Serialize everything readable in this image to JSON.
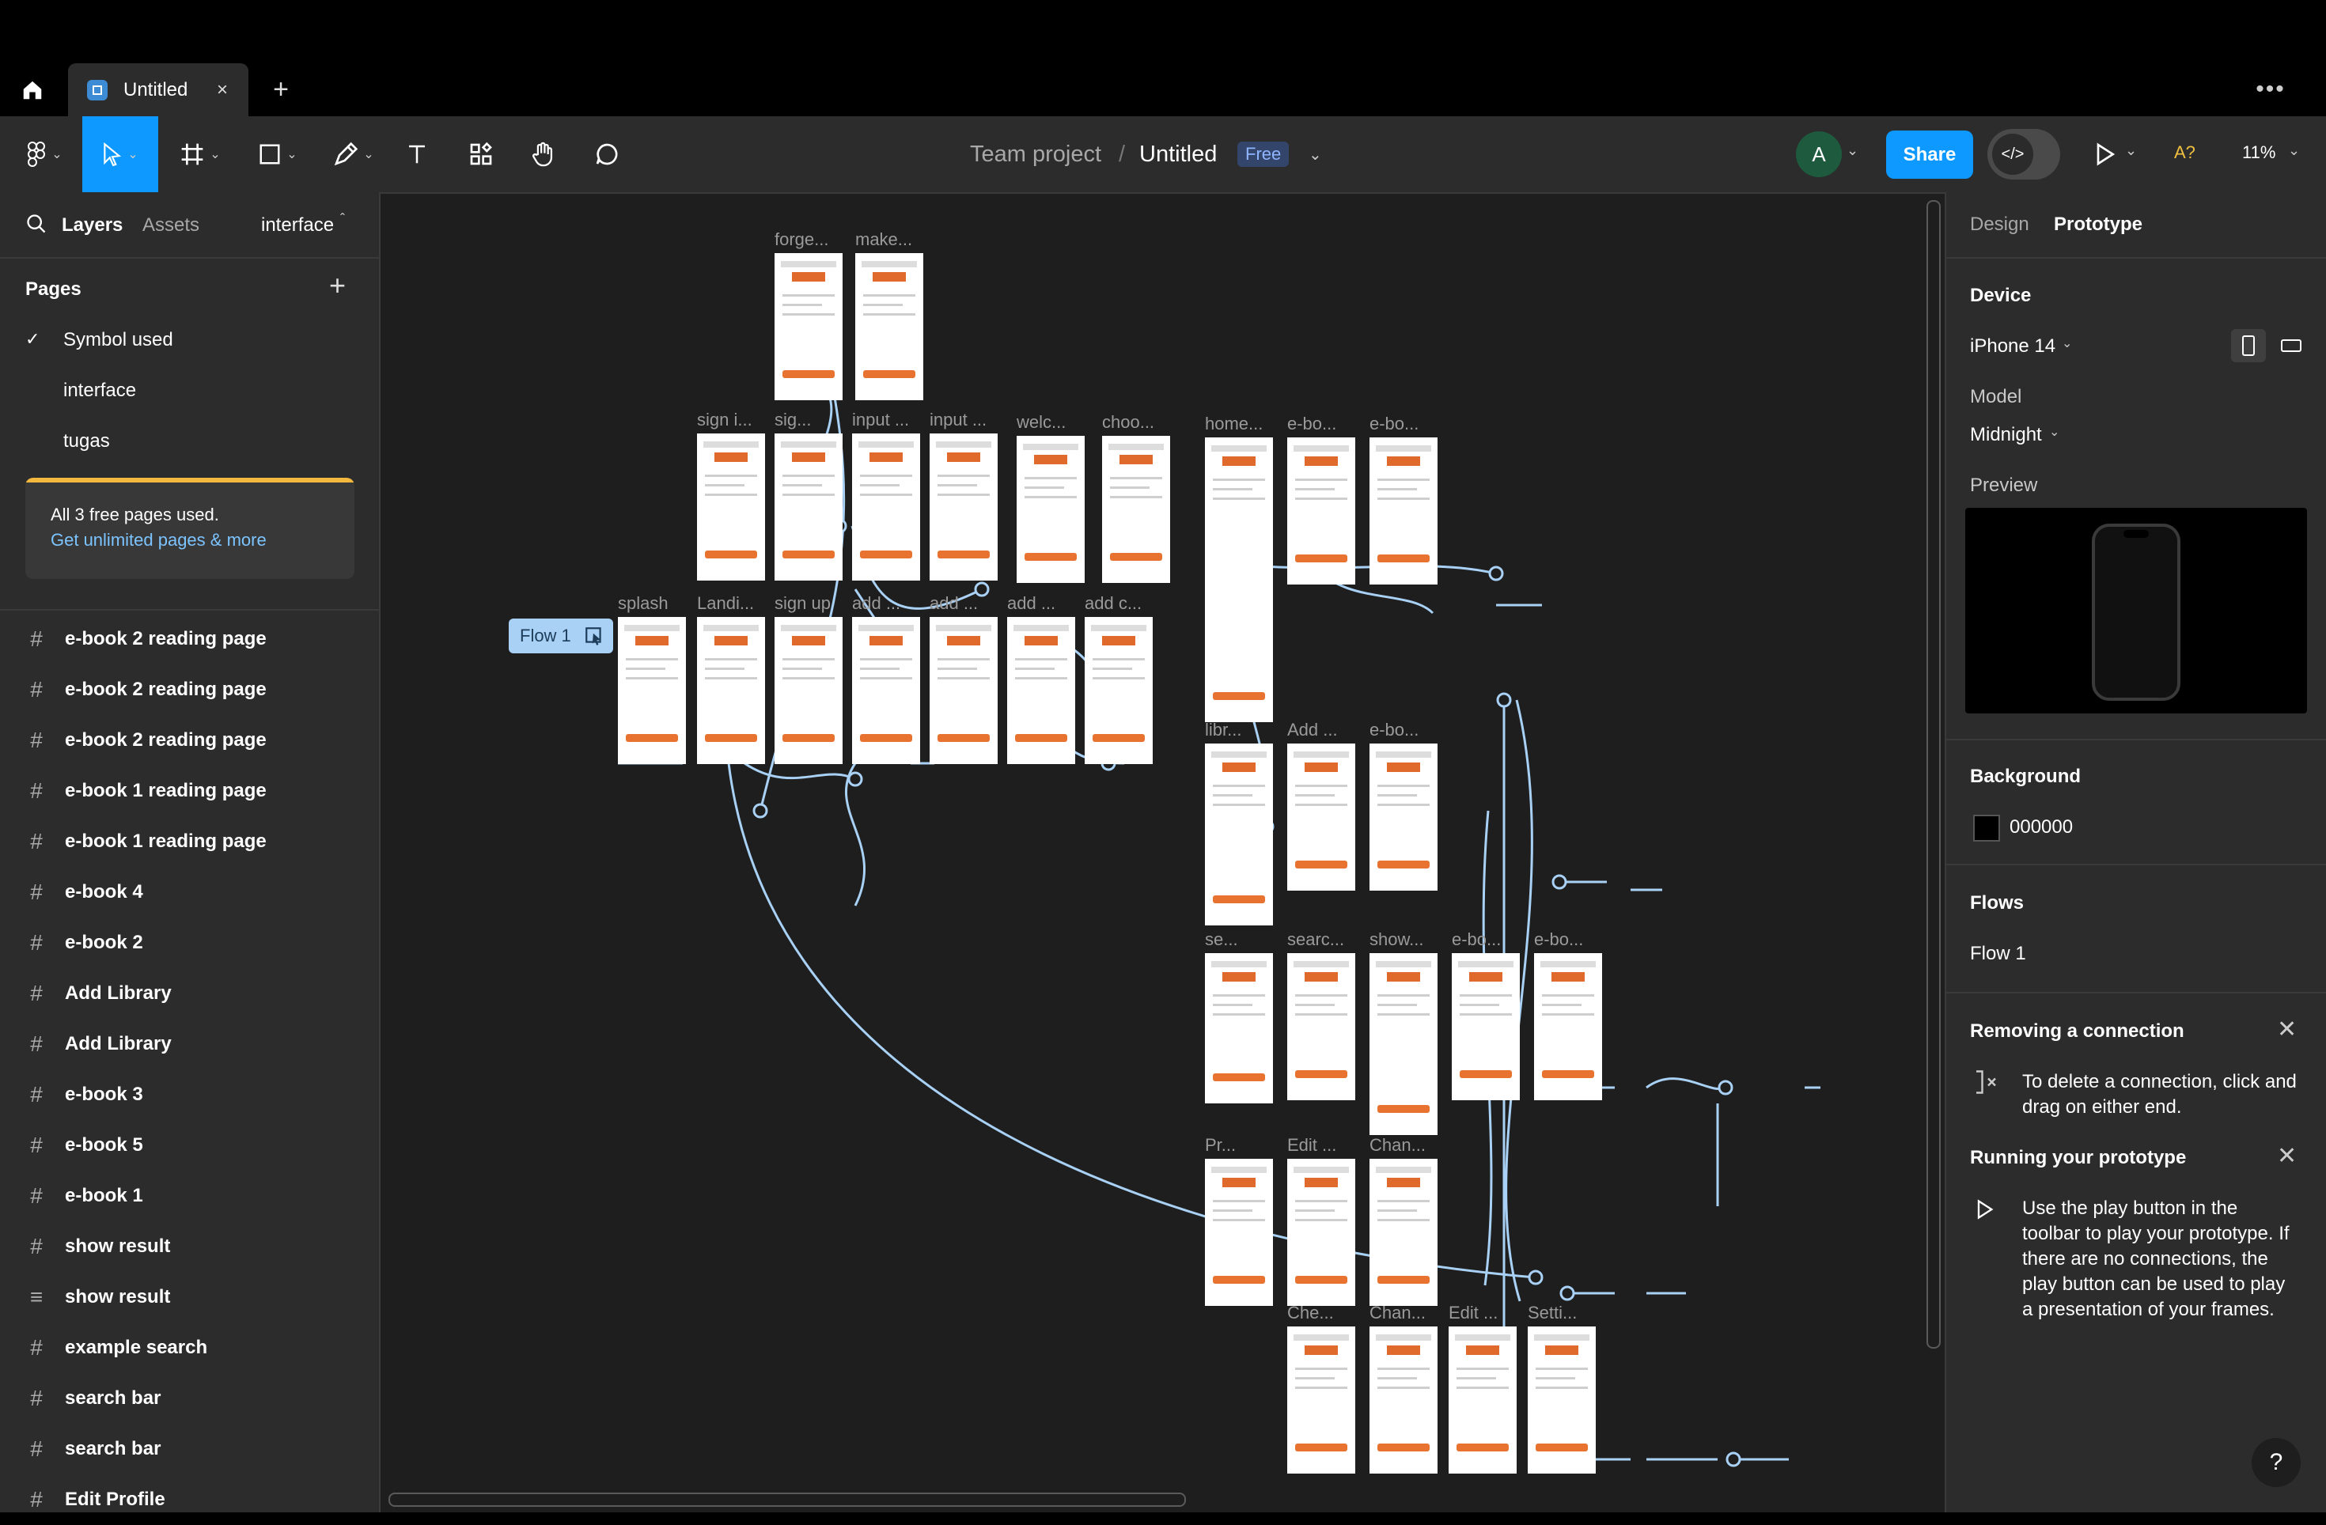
{
  "window": {
    "tab_title": "Untitled",
    "tab_close": "×",
    "add_tab": "+",
    "more": "•••"
  },
  "toolbar": {
    "breadcrumb_project": "Team project",
    "breadcrumb_sep": "/",
    "file_name": "Untitled",
    "plan_badge": "Free",
    "avatar_initial": "A",
    "share_label": "Share",
    "dev_mode_label": "</>",
    "missing_fonts": "A?",
    "zoom": "11%"
  },
  "left_panel": {
    "tabs": {
      "layers": "Layers",
      "assets": "Assets",
      "current_page": "interface"
    },
    "pages_heading": "Pages",
    "add_page": "+",
    "pages": [
      {
        "name": "Symbol used",
        "checked": false
      },
      {
        "name": "interface",
        "checked": true
      },
      {
        "name": "tugas",
        "checked": false
      }
    ],
    "banner": {
      "text": "All 3 free pages used.",
      "link": "Get unlimited pages & more"
    },
    "layers": [
      {
        "name": "e-book 2 reading page",
        "icon": "frame-icon"
      },
      {
        "name": "e-book 2 reading page",
        "icon": "frame-icon"
      },
      {
        "name": "e-book 2 reading page",
        "icon": "frame-icon"
      },
      {
        "name": "e-book 1 reading page",
        "icon": "frame-icon"
      },
      {
        "name": "e-book 1 reading page",
        "icon": "frame-icon"
      },
      {
        "name": "e-book 4",
        "icon": "frame-icon"
      },
      {
        "name": "e-book 2",
        "icon": "frame-icon"
      },
      {
        "name": "Add Library",
        "icon": "frame-icon"
      },
      {
        "name": "Add Library",
        "icon": "frame-icon"
      },
      {
        "name": "e-book 3",
        "icon": "frame-icon"
      },
      {
        "name": "e-book 5",
        "icon": "frame-icon"
      },
      {
        "name": "e-book 1",
        "icon": "frame-icon"
      },
      {
        "name": "show result",
        "icon": "frame-icon"
      },
      {
        "name": "show result",
        "icon": "stack-icon"
      },
      {
        "name": "example search",
        "icon": "frame-icon"
      },
      {
        "name": "search bar",
        "icon": "frame-icon"
      },
      {
        "name": "search bar",
        "icon": "frame-icon"
      },
      {
        "name": "Edit Profile",
        "icon": "frame-icon"
      }
    ]
  },
  "canvas": {
    "flow_tag": "Flow 1",
    "frames": [
      {
        "label": "forge..."
      },
      {
        "label": "make..."
      },
      {
        "label": "sign i..."
      },
      {
        "label": "sig..."
      },
      {
        "label": "input ..."
      },
      {
        "label": "input ..."
      },
      {
        "label": "welc..."
      },
      {
        "label": "choo..."
      },
      {
        "label": "home..."
      },
      {
        "label": "e-bo..."
      },
      {
        "label": "e-bo..."
      },
      {
        "label": "splash"
      },
      {
        "label": "Landi..."
      },
      {
        "label": "sign up"
      },
      {
        "label": "add ..."
      },
      {
        "label": "add ..."
      },
      {
        "label": "add ..."
      },
      {
        "label": "add c..."
      },
      {
        "label": "libr..."
      },
      {
        "label": "Add ..."
      },
      {
        "label": "e-bo..."
      },
      {
        "label": "se..."
      },
      {
        "label": "searc..."
      },
      {
        "label": "show..."
      },
      {
        "label": "e-bo..."
      },
      {
        "label": "e-bo..."
      },
      {
        "label": "Pr..."
      },
      {
        "label": "Edit ..."
      },
      {
        "label": "Chan..."
      },
      {
        "label": "Che..."
      },
      {
        "label": "Chan..."
      },
      {
        "label": "Edit ..."
      },
      {
        "label": "Setti..."
      }
    ]
  },
  "right_panel": {
    "tabs": {
      "design": "Design",
      "prototype": "Prototype"
    },
    "device_heading": "Device",
    "device": "iPhone 14",
    "model_heading": "Model",
    "model": "Midnight",
    "preview_heading": "Preview",
    "background_heading": "Background",
    "background_value": "000000",
    "flows_heading": "Flows",
    "flow_item": "Flow 1",
    "tip1": {
      "title": "Removing a connection",
      "body": "To delete a connection, click and drag on either end."
    },
    "tip2": {
      "title": "Running your prototype",
      "body": "Use the play button in the toolbar to play your prototype. If there are no connections, the play button can be used to play a presentation of your frames."
    },
    "help": "?"
  },
  "colors": {
    "accent": "#0d99ff",
    "canvas": "#1e1e1e",
    "panel": "#2c2c2c",
    "connector": "#a9d1f5",
    "frame_orange": "#e8722f",
    "banner_bar": "#f3b93e"
  }
}
